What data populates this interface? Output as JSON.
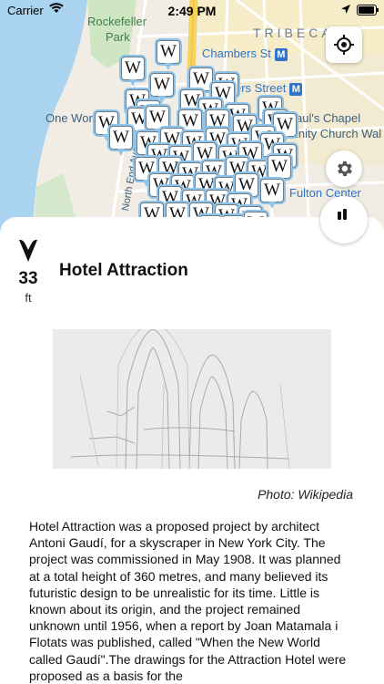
{
  "status_bar": {
    "carrier": "Carrier",
    "time": "2:49 PM"
  },
  "map": {
    "labels": {
      "rockefeller_1": "Rockefeller",
      "rockefeller_2": "Park",
      "tribeca": "TRIBECA",
      "chambers": "Chambers St",
      "chambers_metro": "M",
      "street_partial": "ers Street",
      "street_metro": "M",
      "one_world": "One Wor",
      "pauls_1": "aul's Chapel",
      "pauls_2": "inity Church Wal",
      "fulton": "Fulton Center",
      "north_end": "North End Ave"
    },
    "pin_letter": "W",
    "colors": {
      "water": "#a9d3ef",
      "land": "#f1ede4",
      "highway": "#f6d35a",
      "pin_glow": "#8fc4e8"
    }
  },
  "buttons": {
    "locate_icon": "crosshair-icon",
    "settings_icon": "gear-icon",
    "audio_icon": "audio-icon"
  },
  "place": {
    "title": "Hotel Attraction",
    "distance_value": "33",
    "distance_unit": "ft",
    "photo_caption": "Photo: Wikipedia",
    "description": "Hotel Attraction was a proposed project by architect Antoni Gaudí, for a skyscraper in New York City. The project was commissioned in May 1908. It was planned at a total height of 360 metres, and many believed its futuristic design to be unrealistic for its time. Little is known about its origin, and the project remained unknown until 1956, when a report by Joan Matamala i Flotats was published, called \"When the New World called Gaudí\".The drawings for the Attraction Hotel were proposed as a basis for the"
  }
}
